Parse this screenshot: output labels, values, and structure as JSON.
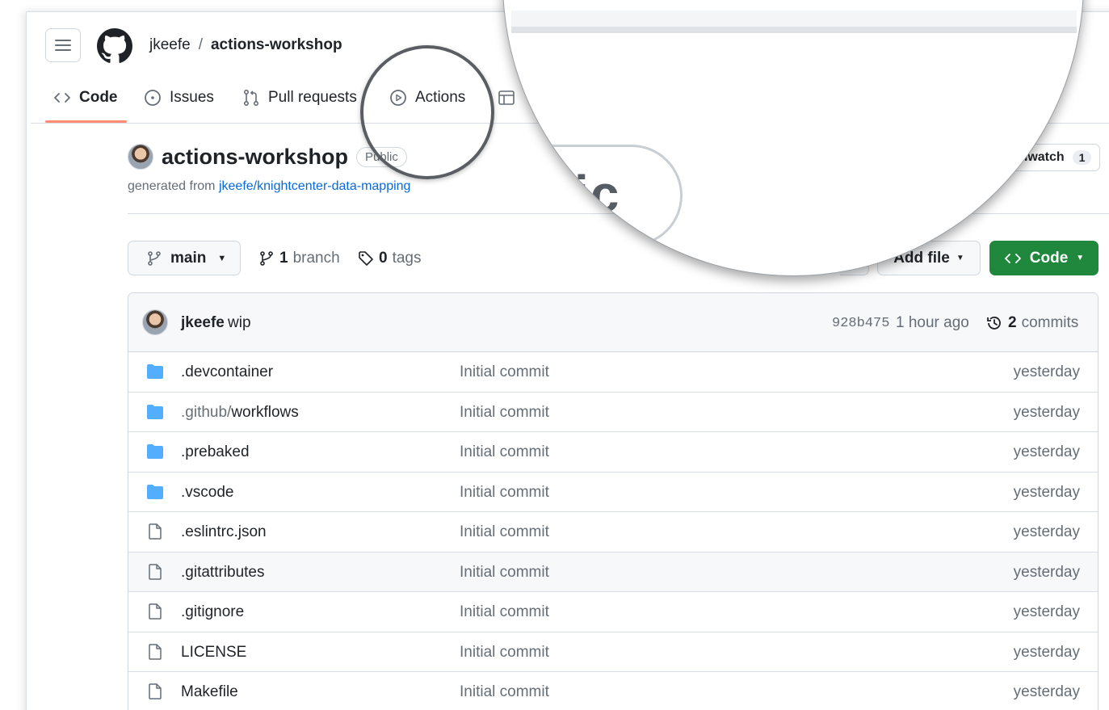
{
  "header": {
    "owner": "jkeefe",
    "separator": "/",
    "repo": "actions-workshop"
  },
  "tabs": [
    {
      "label": "Code",
      "icon": "code-icon",
      "active": true
    },
    {
      "label": "Issues",
      "icon": "issue-icon"
    },
    {
      "label": "Pull requests",
      "icon": "pull-request-icon"
    },
    {
      "label": "Actions",
      "icon": "play-icon"
    },
    {
      "label": "",
      "icon": "table-icon"
    }
  ],
  "repo": {
    "name": "actions-workshop",
    "visibility": "Public",
    "generated_prefix": "generated from",
    "generated_link": "jkeefe/knightcenter-data-mapping",
    "watch_label": "Unwatch",
    "watch_count": "1"
  },
  "toolbar": {
    "branch": "main",
    "branch_count": "1",
    "branch_label": "branch",
    "tag_count": "0",
    "tag_label": "tags",
    "add_file": "Add file",
    "code": "Code"
  },
  "commit": {
    "author": "jkeefe",
    "message": "wip",
    "sha": "928b475",
    "time": "1 hour ago",
    "count": "2",
    "count_label": "commits"
  },
  "files": [
    {
      "type": "dir",
      "name": ".devcontainer",
      "message": "Initial commit",
      "age": "yesterday"
    },
    {
      "type": "dir",
      "name_dim": ".github/",
      "name": "workflows",
      "message": "Initial commit",
      "age": "yesterday"
    },
    {
      "type": "dir",
      "name": ".prebaked",
      "message": "Initial commit",
      "age": "yesterday"
    },
    {
      "type": "dir",
      "name": ".vscode",
      "message": "Initial commit",
      "age": "yesterday"
    },
    {
      "type": "file",
      "name": ".eslintrc.json",
      "message": "Initial commit",
      "age": "yesterday"
    },
    {
      "type": "file",
      "name": ".gitattributes",
      "message": "Initial commit",
      "age": "yesterday"
    },
    {
      "type": "file",
      "name": ".gitignore",
      "message": "Initial commit",
      "age": "yesterday"
    },
    {
      "type": "file",
      "name": "LICENSE",
      "message": "Initial commit",
      "age": "yesterday"
    },
    {
      "type": "file",
      "name": "Makefile",
      "message": "Initial commit",
      "age": "yesterday"
    }
  ],
  "magnifier": {
    "text": "ic"
  },
  "colors": {
    "accent_underline": "#fd8c73",
    "code_button": "#1f883d",
    "link": "#0969da",
    "folder": "#54aeff"
  }
}
